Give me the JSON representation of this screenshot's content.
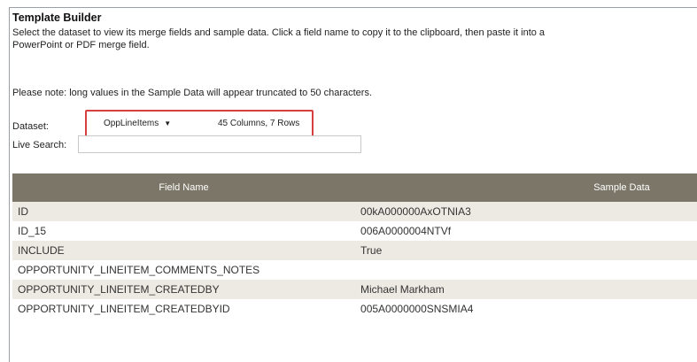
{
  "header": {
    "title": "Template Builder",
    "description_line1": "Select the dataset to view its merge fields and sample data. Click a field name to copy it to the clipboard, then paste it into a",
    "description_line2": "PowerPoint or PDF merge field.",
    "note": "Please note: long values in the Sample Data will appear truncated to 50 characters."
  },
  "dataset": {
    "label": "Dataset:",
    "selected": "OppLineItems",
    "info": "45 Columns, 7 Rows",
    "highlight_color": "#d84040"
  },
  "search": {
    "label": "Live Search:",
    "value": ""
  },
  "table": {
    "header_color": "#7b7668",
    "columns": [
      "Field Name",
      "Sample Data"
    ],
    "rows": [
      {
        "field": "ID",
        "sample": "00kA000000AxOTNIA3"
      },
      {
        "field": "ID_15",
        "sample": "006A0000004NTVf"
      },
      {
        "field": "INCLUDE",
        "sample": "True"
      },
      {
        "field": "OPPORTUNITY_LINEITEM_COMMENTS_NOTES",
        "sample": ""
      },
      {
        "field": "OPPORTUNITY_LINEITEM_CREATEDBY",
        "sample": "Michael Markham"
      },
      {
        "field": "OPPORTUNITY_LINEITEM_CREATEDBYID",
        "sample": "005A0000000SNSMIA4"
      }
    ]
  }
}
